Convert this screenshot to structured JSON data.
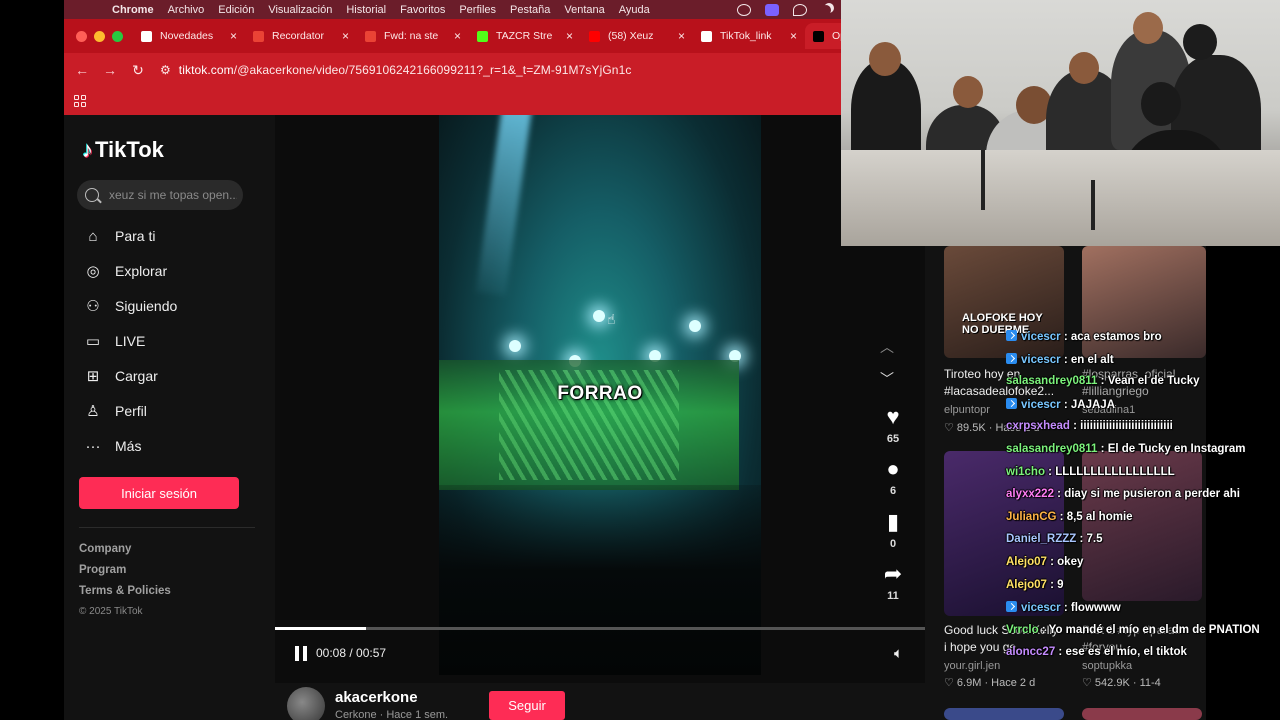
{
  "menubar": {
    "app": "Chrome",
    "items": [
      "Archivo",
      "Edición",
      "Visualización",
      "Historial",
      "Favoritos",
      "Perfiles",
      "Pestaña",
      "Ventana",
      "Ayuda"
    ]
  },
  "tabs": [
    {
      "label": "Novedades",
      "color": "#ffffff"
    },
    {
      "label": "Recordator",
      "color": "#ea4335"
    },
    {
      "label": "Fwd: na ste",
      "color": "#ea4335"
    },
    {
      "label": "TAZCR Stre",
      "color": "#53fc18"
    },
    {
      "label": "(58) Xeuz",
      "color": "#ff0000"
    },
    {
      "label": "TikTok_link",
      "color": "#ffffff"
    },
    {
      "label": "Open",
      "color": "#000000"
    }
  ],
  "address": {
    "host": "tiktok.com",
    "path": "/@akacerkone/video/7569106242166099211?_r=1&_t=ZM-91M7sYjGn1c"
  },
  "tiktok": {
    "brand": "TikTok",
    "search_placeholder": "xeuz si me topas open...",
    "nav": [
      {
        "label": "Para ti",
        "icon": "home-icon"
      },
      {
        "label": "Explorar",
        "icon": "compass-icon"
      },
      {
        "label": "Siguiendo",
        "icon": "following-icon"
      },
      {
        "label": "LIVE",
        "icon": "live-icon"
      },
      {
        "label": "Cargar",
        "icon": "upload-icon"
      },
      {
        "label": "Perfil",
        "icon": "profile-icon"
      },
      {
        "label": "Más",
        "icon": "more-icon"
      }
    ],
    "login_label": "Iniciar sesión",
    "footer_links": [
      "Company",
      "Program",
      "Terms & Policies"
    ],
    "copyright": "© 2025 TikTok",
    "video": {
      "caption": "FORRAO",
      "time": "00:08 / 00:57",
      "progress": 0.14
    },
    "actions": {
      "likes": "65",
      "comments": "6",
      "saves": "0",
      "shares": "11"
    },
    "author": {
      "handle": "akacerkone",
      "sub": "Cerkone · Hace 1 sem.",
      "follow_label": "Seguir"
    }
  },
  "suggestions": [
    {
      "title": "Tiroteo hoy en #lacasadealofoke2...",
      "author": "elpuntopr",
      "views": "89.5K",
      "date": "Hace 2 d",
      "overlay": "ALOFOKE HOY NO DUERME"
    },
    {
      "title": "#losparras_oficial #lilliangriego",
      "author": "sebadiina1",
      "views": "",
      "date": "",
      "overlay": ""
    },
    {
      "title": "Good luck Scott Kelly i hope you ge...",
      "author": "your.girl.jen",
      "views": "6.9M",
      "date": "Hace 2 d",
      "overlay": ""
    },
    {
      "title": "Part 1 #fyp #parati #foryou",
      "author": "soptupkka",
      "views": "542.9K",
      "date": "11-4",
      "overlay": ""
    }
  ],
  "chat": [
    {
      "user": "vicescr",
      "msg": "aca estamos bro",
      "color": "#79c7ff",
      "badge": true
    },
    {
      "user": "vicescr",
      "msg": "en el alt",
      "color": "#79c7ff",
      "badge": true
    },
    {
      "user": "salasandrey0811",
      "msg": "Vean el de Tucky",
      "color": "#7cf27c",
      "badge": false
    },
    {
      "user": "vicescr",
      "msg": "JAJAJA",
      "color": "#79c7ff",
      "badge": true
    },
    {
      "user": "cxrpsxhead",
      "msg": "iiiiiiiiiiiiiiiiiiiiiiiiiiiii",
      "color": "#c58cff",
      "badge": false
    },
    {
      "user": "salasandrey0811",
      "msg": "El de Tucky en Instagram",
      "color": "#7cf27c",
      "badge": false
    },
    {
      "user": "wi1cho",
      "msg": "LLLLLLLLLLLLLLLLL",
      "color": "#7cf27c",
      "badge": false
    },
    {
      "user": "alyxx222",
      "msg": "diay si me pusieron a perder ahi",
      "color": "#ff7cf5",
      "badge": false
    },
    {
      "user": "JulianCG",
      "msg": "8,5 al homie",
      "color": "#ffb347",
      "badge": false
    },
    {
      "user": "Daniel_RZZZ",
      "msg": "7.5",
      "color": "#a9c6ff",
      "badge": false
    },
    {
      "user": "Alejo07",
      "msg": "okey",
      "color": "#ffe066",
      "badge": false
    },
    {
      "user": "Alejo07",
      "msg": "9",
      "color": "#ffe066",
      "badge": false
    },
    {
      "user": "vicescr",
      "msg": "flowwww",
      "color": "#79c7ff",
      "badge": true
    },
    {
      "user": "Vrrclo",
      "msg": "Yo mandé el mío en el dm de PNATION",
      "color": "#7cf27c",
      "badge": false
    },
    {
      "user": "aloncc27",
      "msg": "ese es el mío, el tiktok",
      "color": "#c58cff",
      "badge": false
    }
  ]
}
